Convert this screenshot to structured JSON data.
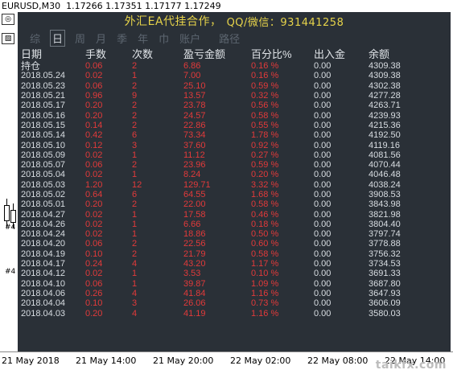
{
  "chart_header": {
    "symbol": "EURUSD,M30",
    "open": "1.17266",
    "high": "1.17351",
    "low": "1.17177",
    "close": "1.17249"
  },
  "left_strip": {
    "icon1": "◎",
    "icon2": "▧",
    "mark1": "#4",
    "mark2": "#4"
  },
  "panel": {
    "title": "外汇EA代挂合作，",
    "contact": "QQ/微信：931441258",
    "tabs": [
      "综",
      "日",
      "周",
      "月",
      "季",
      "年",
      "巾",
      "账户",
      "路径"
    ],
    "active_tab": "日",
    "columns": [
      "日期",
      "手数",
      "次数",
      "盈亏金额",
      "百分比%",
      "出入金",
      "余额"
    ],
    "rows": [
      {
        "date": "持仓",
        "lots": "0.06",
        "count": "2",
        "pnl": "6.86",
        "pct": "0.16 %",
        "dep": "0.00",
        "bal": "4309.38"
      },
      {
        "date": "2018.05.24",
        "lots": "0.02",
        "count": "1",
        "pnl": "7.00",
        "pct": "0.16 %",
        "dep": "0.00",
        "bal": "4309.38"
      },
      {
        "date": "2018.05.23",
        "lots": "0.06",
        "count": "2",
        "pnl": "25.10",
        "pct": "0.59 %",
        "dep": "0.00",
        "bal": "4302.38"
      },
      {
        "date": "2018.05.21",
        "lots": "0.96",
        "count": "9",
        "pnl": "13.57",
        "pct": "0.32 %",
        "dep": "0.00",
        "bal": "4277.28"
      },
      {
        "date": "2018.05.17",
        "lots": "0.20",
        "count": "2",
        "pnl": "23.78",
        "pct": "0.56 %",
        "dep": "0.00",
        "bal": "4263.71"
      },
      {
        "date": "2018.05.16",
        "lots": "0.20",
        "count": "2",
        "pnl": "24.57",
        "pct": "0.58 %",
        "dep": "0.00",
        "bal": "4239.93"
      },
      {
        "date": "2018.05.15",
        "lots": "0.14",
        "count": "2",
        "pnl": "22.86",
        "pct": "0.55 %",
        "dep": "0.00",
        "bal": "4215.36"
      },
      {
        "date": "2018.05.14",
        "lots": "0.42",
        "count": "6",
        "pnl": "73.34",
        "pct": "1.78 %",
        "dep": "0.00",
        "bal": "4192.50"
      },
      {
        "date": "2018.05.10",
        "lots": "0.12",
        "count": "3",
        "pnl": "37.60",
        "pct": "0.92 %",
        "dep": "0.00",
        "bal": "4119.16"
      },
      {
        "date": "2018.05.09",
        "lots": "0.02",
        "count": "1",
        "pnl": "11.12",
        "pct": "0.27 %",
        "dep": "0.00",
        "bal": "4081.56"
      },
      {
        "date": "2018.05.07",
        "lots": "0.06",
        "count": "2",
        "pnl": "23.96",
        "pct": "0.59 %",
        "dep": "0.00",
        "bal": "4070.44"
      },
      {
        "date": "2018.05.04",
        "lots": "0.02",
        "count": "1",
        "pnl": "8.24",
        "pct": "0.20 %",
        "dep": "0.00",
        "bal": "4046.48"
      },
      {
        "date": "2018.05.03",
        "lots": "1.20",
        "count": "12",
        "pnl": "129.71",
        "pct": "3.32 %",
        "dep": "0.00",
        "bal": "4038.24"
      },
      {
        "date": "2018.05.02",
        "lots": "0.64",
        "count": "6",
        "pnl": "64.55",
        "pct": "1.68 %",
        "dep": "0.00",
        "bal": "3908.53"
      },
      {
        "date": "2018.05.01",
        "lots": "0.20",
        "count": "2",
        "pnl": "22.00",
        "pct": "0.58 %",
        "dep": "0.00",
        "bal": "3843.98"
      },
      {
        "date": "2018.04.27",
        "lots": "0.02",
        "count": "1",
        "pnl": "17.58",
        "pct": "0.46 %",
        "dep": "0.00",
        "bal": "3821.98"
      },
      {
        "date": "2018.04.26",
        "lots": "0.02",
        "count": "1",
        "pnl": "6.66",
        "pct": "0.18 %",
        "dep": "0.00",
        "bal": "3804.40"
      },
      {
        "date": "2018.04.24",
        "lots": "0.02",
        "count": "1",
        "pnl": "18.86",
        "pct": "0.50 %",
        "dep": "0.00",
        "bal": "3797.74"
      },
      {
        "date": "2018.04.20",
        "lots": "0.06",
        "count": "2",
        "pnl": "22.56",
        "pct": "0.60 %",
        "dep": "0.00",
        "bal": "3778.88"
      },
      {
        "date": "2018.04.19",
        "lots": "0.10",
        "count": "2",
        "pnl": "21.79",
        "pct": "0.58 %",
        "dep": "0.00",
        "bal": "3756.32"
      },
      {
        "date": "2018.04.17",
        "lots": "0.24",
        "count": "4",
        "pnl": "43.20",
        "pct": "1.17 %",
        "dep": "0.00",
        "bal": "3734.53"
      },
      {
        "date": "2018.04.12",
        "lots": "0.02",
        "count": "1",
        "pnl": "3.53",
        "pct": "0.10 %",
        "dep": "0.00",
        "bal": "3691.33"
      },
      {
        "date": "2018.04.10",
        "lots": "0.06",
        "count": "1",
        "pnl": "39.87",
        "pct": "1.09 %",
        "dep": "0.00",
        "bal": "3687.80"
      },
      {
        "date": "2018.04.06",
        "lots": "0.26",
        "count": "4",
        "pnl": "41.84",
        "pct": "1.16 %",
        "dep": "0.00",
        "bal": "3647.93"
      },
      {
        "date": "2018.04.04",
        "lots": "0.10",
        "count": "3",
        "pnl": "26.06",
        "pct": "0.73 %",
        "dep": "0.00",
        "bal": "3606.09"
      },
      {
        "date": "2018.04.03",
        "lots": "0.20",
        "count": "4",
        "pnl": "41.19",
        "pct": "1.16 %",
        "dep": "0.00",
        "bal": "3580.03"
      }
    ]
  },
  "time_axis": [
    "21 May 2018",
    "21 May 14:00",
    "21 May 20:00",
    "22 May 02:00",
    "22 May 08:00",
    "22 May 14:00"
  ],
  "watermark": "taikfx.com"
}
